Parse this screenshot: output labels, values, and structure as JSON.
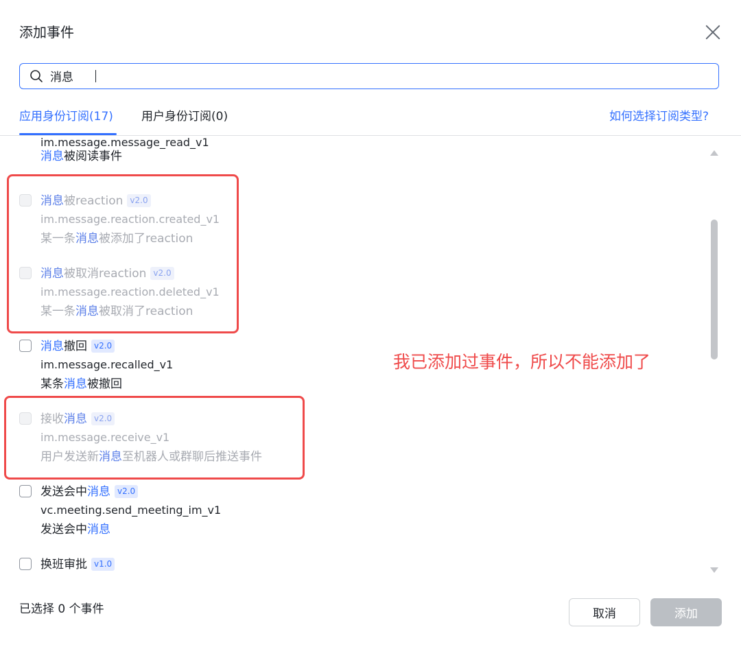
{
  "dialog": {
    "title": "添加事件",
    "search": {
      "value": "消息",
      "placeholder": ""
    },
    "tabs": [
      {
        "label": "应用身份订阅(17)",
        "active": true
      },
      {
        "label": "用户身份订阅(0)",
        "active": false
      }
    ],
    "help_link": "如何选择订阅类型?",
    "partial_item": {
      "code": "im.message.message_read_v1",
      "desc_hl": "消息",
      "desc_rest": "被阅读事件"
    },
    "events": [
      {
        "name_pre": "",
        "name_hl": "消息",
        "name_post": "被reaction",
        "version": "v2.0",
        "code": "im.message.reaction.created_v1",
        "desc_pre": "某一条",
        "desc_hl": "消息",
        "desc_post": "被添加了reaction",
        "disabled": true
      },
      {
        "name_pre": "",
        "name_hl": "消息",
        "name_post": "被取消reaction",
        "version": "v2.0",
        "code": "im.message.reaction.deleted_v1",
        "desc_pre": "某一条",
        "desc_hl": "消息",
        "desc_post": "被取消了reaction",
        "disabled": true
      },
      {
        "name_pre": "",
        "name_hl": "消息",
        "name_post": "撤回",
        "version": "v2.0",
        "code": "im.message.recalled_v1",
        "desc_pre": "某条",
        "desc_hl": "消息",
        "desc_post": "被撤回",
        "disabled": false
      },
      {
        "name_pre": "接收",
        "name_hl": "消息",
        "name_post": "",
        "version": "v2.0",
        "code": "im.message.receive_v1",
        "desc_pre": "用户发送新",
        "desc_hl": "消息",
        "desc_post": "至机器人或群聊后推送事件",
        "disabled": true
      },
      {
        "name_pre": "发送会中",
        "name_hl": "消息",
        "name_post": "",
        "version": "v2.0",
        "code": "vc.meeting.send_meeting_im_v1",
        "desc_pre": "发送会中",
        "desc_hl": "消息",
        "desc_post": "",
        "disabled": false
      },
      {
        "name_pre": "换班审批",
        "name_hl": "",
        "name_post": "",
        "version": "v1.0",
        "code": "",
        "desc_pre": "",
        "desc_hl": "",
        "desc_post": "",
        "disabled": false
      }
    ],
    "annotation": "我已添加过事件，所以不能添加了",
    "footer": {
      "selected_count": "已选择 0 个事件",
      "cancel_label": "取消",
      "add_label": "添加"
    }
  },
  "colors": {
    "accent": "#3370ff",
    "annotation": "#ef4a4a",
    "disabled_button": "#bbbfc4"
  }
}
